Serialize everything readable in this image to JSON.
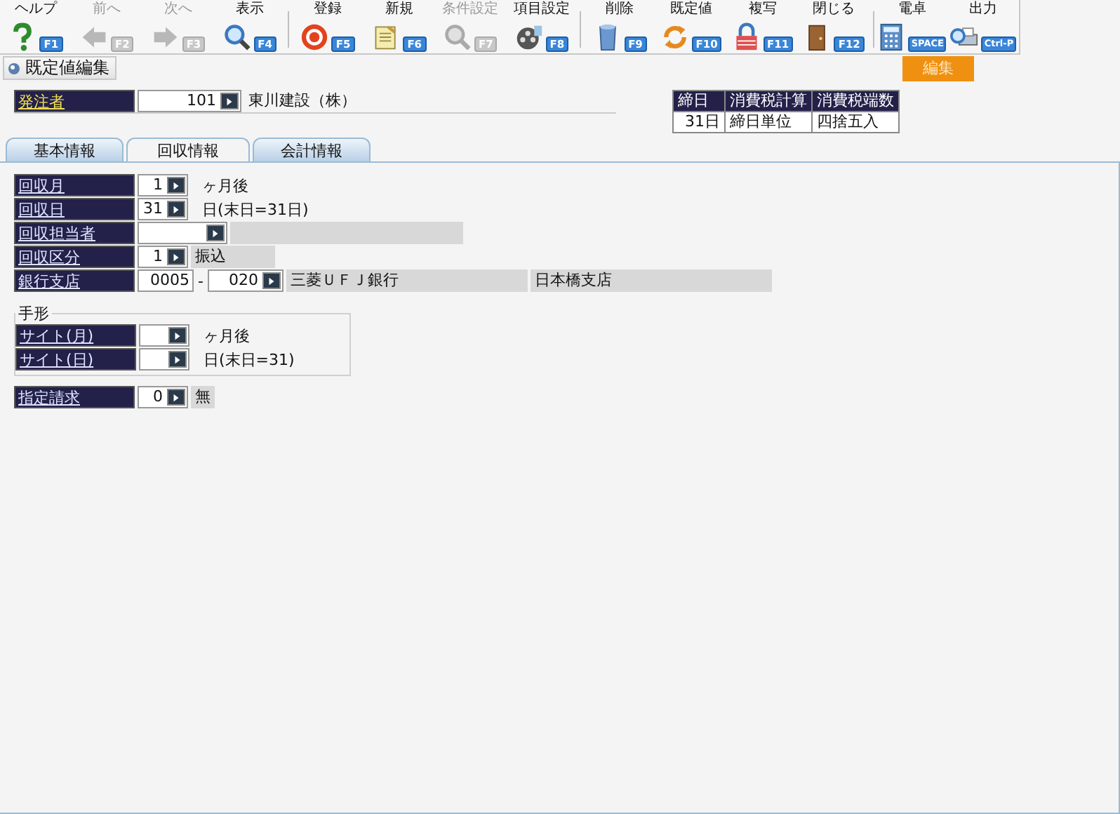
{
  "toolbar_groups": [
    [
      {
        "label": "ヘルプ",
        "key": "F1",
        "disabled": false
      },
      {
        "label": "前へ",
        "key": "F2",
        "disabled": true
      },
      {
        "label": "次へ",
        "key": "F3",
        "disabled": true
      },
      {
        "label": "表示",
        "key": "F4",
        "disabled": false
      }
    ],
    [
      {
        "label": "登録",
        "key": "F5",
        "disabled": false
      },
      {
        "label": "新規",
        "key": "F6",
        "disabled": false
      },
      {
        "label": "条件設定",
        "key": "F7",
        "disabled": true
      },
      {
        "label": "項目設定",
        "key": "F8",
        "disabled": false
      }
    ],
    [
      {
        "label": "削除",
        "key": "F9",
        "disabled": false
      },
      {
        "label": "既定値",
        "key": "F10",
        "disabled": false
      },
      {
        "label": "複写",
        "key": "F11",
        "disabled": false
      },
      {
        "label": "閉じる",
        "key": "F12",
        "disabled": false
      }
    ],
    [
      {
        "label": "電卓",
        "key": "SPACE",
        "disabled": false
      },
      {
        "label": "出力",
        "key": "Ctrl-P",
        "disabled": false
      }
    ]
  ],
  "mode_button": "既定値編集",
  "edit_badge": "編集",
  "customer": {
    "label": "発注者",
    "code": "101",
    "name": "東川建設（株）"
  },
  "tax_table": {
    "columns": [
      "締日",
      "消費税計算",
      "消費税端数"
    ],
    "row": [
      "31日",
      "締日単位",
      "四捨五入"
    ]
  },
  "tabs": [
    {
      "label": "基本情報",
      "selected": false
    },
    {
      "label": "回収情報",
      "selected": true
    },
    {
      "label": "会計情報",
      "selected": false
    }
  ],
  "fields": [
    {
      "kind": "note",
      "label": "回収月",
      "value": "1",
      "note": "ヶ月後"
    },
    {
      "kind": "note",
      "label": "回収日",
      "value": "31",
      "note": "日(末日=31日)"
    },
    {
      "kind": "blank",
      "label": "回収担当者"
    },
    {
      "kind": "name",
      "label": "回収区分",
      "value": "1",
      "name": "振込"
    },
    {
      "kind": "bank",
      "label": "銀行支店",
      "codes": [
        "0005",
        "020"
      ],
      "separator": "-",
      "names": [
        "三菱ＵＦＪ銀行",
        "日本橋支店"
      ]
    }
  ],
  "bill_group": {
    "title": "手形",
    "fields": [
      {
        "kind": "note",
        "label": "サイト(月)",
        "note": "ヶ月後"
      },
      {
        "kind": "note",
        "label": "サイト(日)",
        "note": "日(末日=31)"
      }
    ]
  },
  "extra_fields": [
    {
      "kind": "name",
      "label": "指定請求",
      "value": "0",
      "name": "無"
    }
  ]
}
